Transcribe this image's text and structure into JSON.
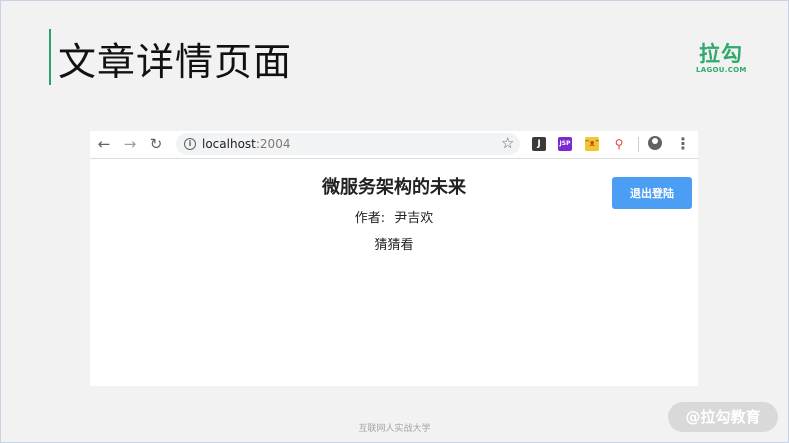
{
  "slide": {
    "title": "文章详情页面",
    "brand_cn": "拉勾",
    "brand_en": "LAGOU.COM",
    "footer": "互联网人实战大学",
    "watermark": "@拉勾教育"
  },
  "browser": {
    "nav": {
      "back_icon": "←",
      "forward_icon": "→",
      "reload_icon": "↻"
    },
    "address": {
      "host": "localhost",
      "port": ":2004"
    },
    "extensions": {
      "j": "J",
      "jsp": "JSP",
      "face": "ᵔᴥᵔ",
      "fx": "⚲"
    }
  },
  "page": {
    "article_title": "微服务架构的未来",
    "author_label": "作者:",
    "author_name": "尹吉欢",
    "body": "猜猜看",
    "logout_label": "退出登陆"
  },
  "colors": {
    "accent": "#2f9e6f",
    "brand": "#2faa6b",
    "button": "#4c9ef4"
  }
}
